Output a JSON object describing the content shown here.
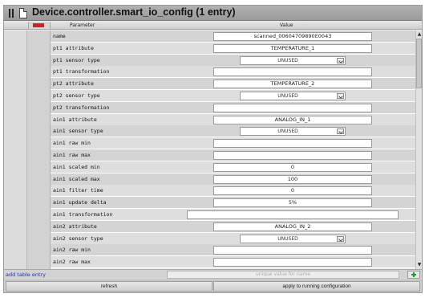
{
  "title": "Device.controller.smart_io_config (1 entry)",
  "header": {
    "parameter": "Parameter",
    "value": "Value"
  },
  "rows": [
    {
      "label": "name",
      "type": "text",
      "value": "scanned_00604709890E0043"
    },
    {
      "label": "pt1 attribute",
      "type": "text",
      "value": "TEMPERATURE_1"
    },
    {
      "label": "pt1 sensor type",
      "type": "select",
      "value": "UNUSED"
    },
    {
      "label": "pt1 transformation",
      "type": "text",
      "value": ""
    },
    {
      "label": "pt2 attribute",
      "type": "text",
      "value": "TEMPERATURE_2"
    },
    {
      "label": "pt2 sensor type",
      "type": "select",
      "value": "UNUSED"
    },
    {
      "label": "pt2 transformation",
      "type": "text",
      "value": ""
    },
    {
      "label": "ain1 attribute",
      "type": "text",
      "value": "ANALOG_IN_1"
    },
    {
      "label": "ain1 sensor type",
      "type": "select",
      "value": "UNUSED"
    },
    {
      "label": "ain1 raw min",
      "type": "text",
      "value": ""
    },
    {
      "label": "ain1 raw max",
      "type": "text",
      "value": ""
    },
    {
      "label": "ain1 scaled min",
      "type": "text",
      "value": "0"
    },
    {
      "label": "ain1 scaled max",
      "type": "text",
      "value": "100"
    },
    {
      "label": "ain1 filter time",
      "type": "text",
      "value": "0"
    },
    {
      "label": "ain1 update delta",
      "type": "text",
      "value": "5%"
    },
    {
      "label": "ain1 transformation",
      "type": "wide",
      "value": ""
    },
    {
      "label": "ain2 attribute",
      "type": "text",
      "value": "ANALOG_IN_2"
    },
    {
      "label": "ain2 sensor type",
      "type": "select",
      "value": "UNUSED"
    },
    {
      "label": "ain2 raw min",
      "type": "text",
      "value": ""
    },
    {
      "label": "ain2 raw max",
      "type": "text",
      "value": ""
    }
  ],
  "footer": {
    "add_label": "add table entry",
    "new_placeholder": "unique value for name",
    "refresh_label": "refresh",
    "apply_label": "apply to running configuration"
  }
}
